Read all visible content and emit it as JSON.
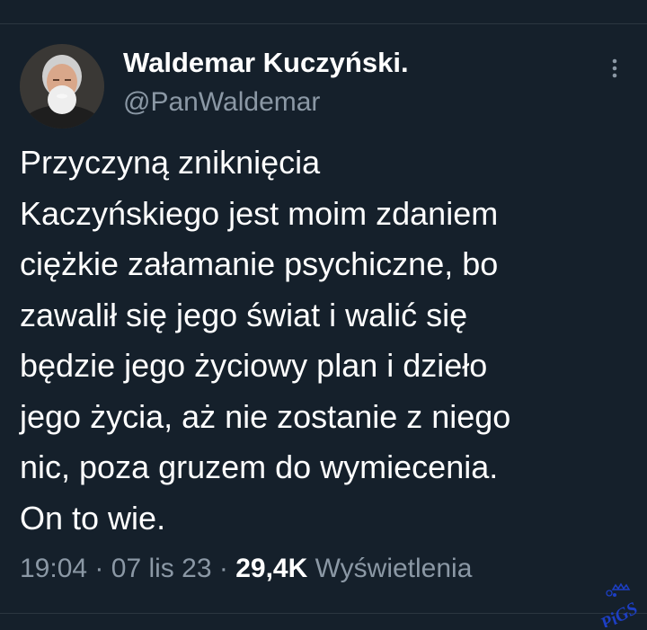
{
  "author": {
    "display_name": "Waldemar Kuczyński.",
    "handle": "@PanWaldemar"
  },
  "tweet": {
    "lines": [
      "Przyczyną zniknięcia",
      "Kaczyńskiego jest moim zdaniem",
      "ciężkie załamanie psychiczne, bo",
      "zawalił się jego świat i walić się",
      "będzie jego życiowy plan i dzieło",
      "jego życia, aż nie zostanie z niego",
      "nic, poza gruzem do wymiecenia.",
      "On to wie."
    ]
  },
  "meta": {
    "time": "19:04",
    "separator": "·",
    "date": "07 lis 23",
    "views_count": "29,4K",
    "views_label": "Wyświetlenia"
  },
  "watermark": {
    "text": "PiGS"
  },
  "icons": {
    "more": "more-vertical-icon",
    "watermark": "pigs-logo"
  },
  "colors": {
    "background": "#15202b",
    "text_primary": "#ffffff",
    "text_secondary": "#8b98a5",
    "divider": "#2b3640",
    "watermark": "#1d3fc4"
  }
}
